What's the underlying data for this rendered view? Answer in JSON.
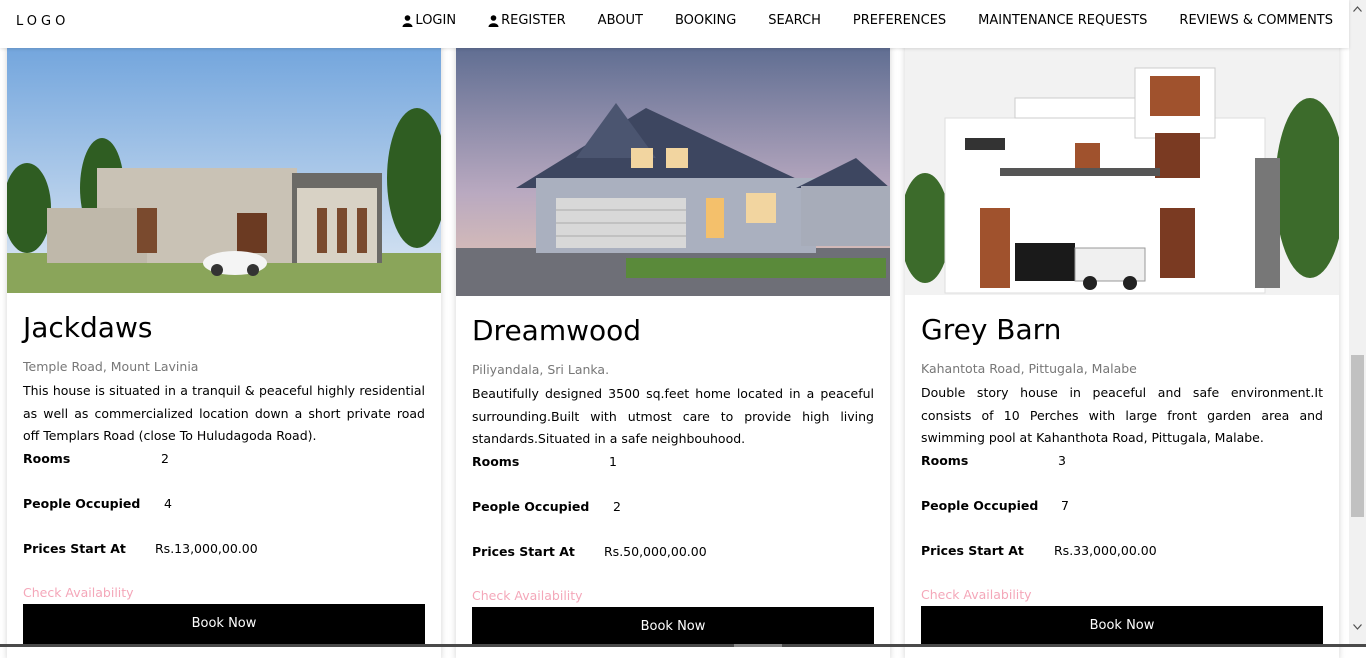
{
  "nav": {
    "logo": "LOGO",
    "links": [
      {
        "label": "LOGIN",
        "icon": "user-icon"
      },
      {
        "label": "REGISTER",
        "icon": "user-icon"
      },
      {
        "label": "ABOUT"
      },
      {
        "label": "BOOKING"
      },
      {
        "label": "SEARCH"
      },
      {
        "label": "PREFERENCES"
      },
      {
        "label": "MAINTENANCE REQUESTS"
      },
      {
        "label": "REVIEWS & COMMENTS"
      }
    ]
  },
  "labels": {
    "rooms": "Rooms",
    "people": "People Occupied",
    "price": "Prices Start At",
    "check": "Check Availability",
    "book": "Book Now"
  },
  "properties": [
    {
      "name": "Jackdaws",
      "address": "Temple Road, Mount Lavinia",
      "description": "This house is situated in a tranquil & peaceful highly residential as well as commercialized location down a short private road off Templars Road (close To Huludagoda Road).",
      "rooms": "2",
      "people": "4",
      "price": "Rs.13,000,00.00"
    },
    {
      "name": "Dreamwood",
      "address": "Piliyandala, Sri Lanka.",
      "description": "Beautifully designed 3500 sq.feet home located in a peaceful surrounding.Built with utmost care to provide high living standards.Situated in a safe neighbouhood.",
      "rooms": "1",
      "people": "2",
      "price": "Rs.50,000,00.00"
    },
    {
      "name": "Grey Barn",
      "address": "Kahantota Road, Pittugala, Malabe",
      "description": "Double story house in peaceful and safe environment.It consists of 10 Perches with large front garden area and swimming pool at Kahanthota Road, Pittugala, Malabe.",
      "rooms": "3",
      "people": "7",
      "price": "Rs.33,000,00.00"
    }
  ]
}
